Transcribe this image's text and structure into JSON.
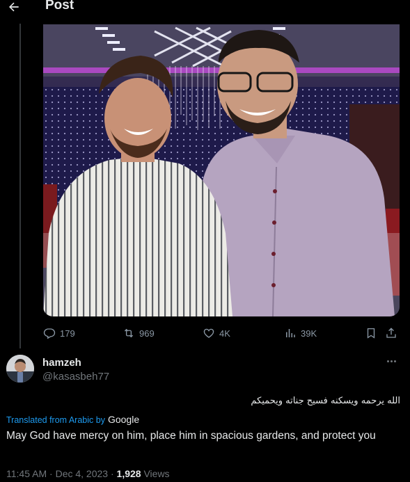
{
  "header": {
    "title": "Post",
    "back_icon": "arrow-left-icon"
  },
  "actions": {
    "replies": "179",
    "reposts": "969",
    "likes": "4K",
    "views": "39K",
    "icons": [
      "reply-icon",
      "repost-icon",
      "like-icon",
      "views-icon",
      "bookmark-icon",
      "share-icon"
    ]
  },
  "reply": {
    "display_name": "hamzeh",
    "handle": "@kasasbeh77",
    "original_text": "الله يرحمه ويسكنه فسيح جناته ويحميكم",
    "translated_label": "Translated from Arabic by",
    "translator": "Google",
    "translation": "May God have mercy on him, place him in spacious gardens, and protect you",
    "time": "11:45 AM",
    "date": "Dec 4, 2023",
    "views_count": "1,928",
    "views_label": "Views"
  },
  "colors": {
    "accent": "#1d9bf0",
    "muted": "#71767b",
    "text": "#e7e9ea",
    "background": "#000000"
  }
}
